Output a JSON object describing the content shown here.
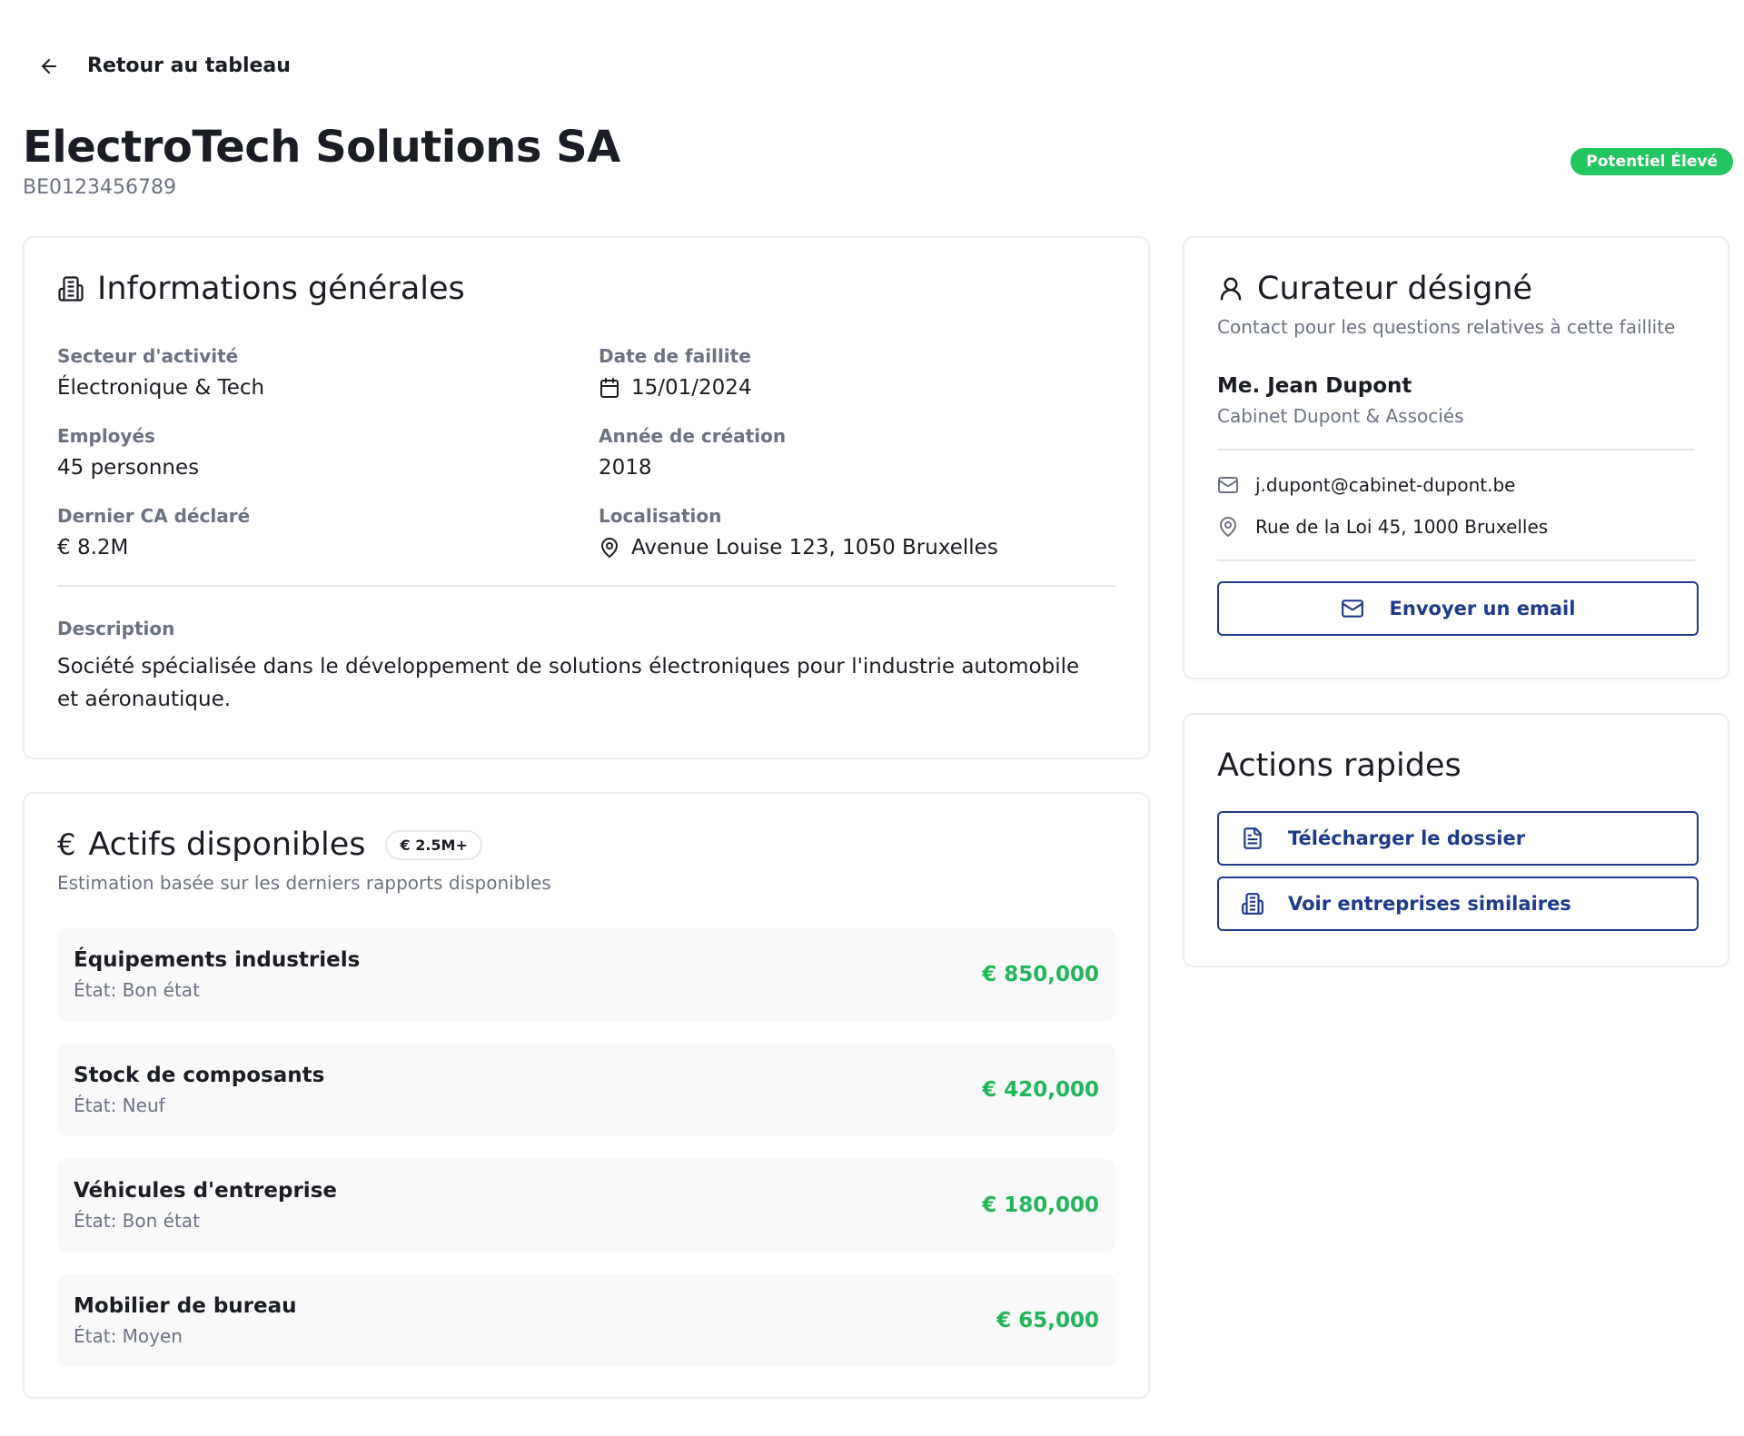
{
  "nav": {
    "back_label": "Retour au tableau"
  },
  "header": {
    "title": "ElectroTech Solutions SA",
    "company_id": "BE0123456789",
    "potential_badge": "Potentiel Élevé",
    "badge_color": "#22c55e"
  },
  "info": {
    "title": "Informations générales",
    "sector_label": "Secteur d'activité",
    "sector_value": "Électronique & Tech",
    "bankruptcy_date_label": "Date de faillite",
    "bankruptcy_date_value": "15/01/2024",
    "employees_label": "Employés",
    "employees_value": "45 personnes",
    "founded_label": "Année de création",
    "founded_value": "2018",
    "revenue_label": "Dernier CA déclaré",
    "revenue_value": "€ 8.2M",
    "location_label": "Localisation",
    "location_value": "Avenue Louise 123, 1050 Bruxelles",
    "description_label": "Description",
    "description_value": "Société spécialisée dans le développement de solutions électroniques pour l'industrie automobile et aéronautique."
  },
  "assets": {
    "icon": "€",
    "title": "Actifs disponibles",
    "amount_badge": "€ 2.5M+",
    "subtitle": "Estimation basée sur les derniers rapports disponibles",
    "value_color": "#22b55a",
    "items": [
      {
        "name": "Équipements industriels",
        "state": "État: Bon état",
        "value": "€ 850,000"
      },
      {
        "name": "Stock de composants",
        "state": "État: Neuf",
        "value": "€ 420,000"
      },
      {
        "name": "Véhicules d'entreprise",
        "state": "État: Bon état",
        "value": "€ 180,000"
      },
      {
        "name": "Mobilier de bureau",
        "state": "État: Moyen",
        "value": "€ 65,000"
      }
    ]
  },
  "curator": {
    "title": "Curateur désigné",
    "subtitle": "Contact pour les questions relatives à cette faillite",
    "name": "Me. Jean Dupont",
    "firm": "Cabinet Dupont & Associés",
    "email": "j.dupont@cabinet-dupont.be",
    "address": "Rue de la Loi 45, 1000 Bruxelles",
    "email_button": "Envoyer un email"
  },
  "actions": {
    "title": "Actions rapides",
    "download_label": "Télécharger le dossier",
    "similar_label": "Voir entreprises similaires",
    "accent_color": "#1e3a8a"
  }
}
